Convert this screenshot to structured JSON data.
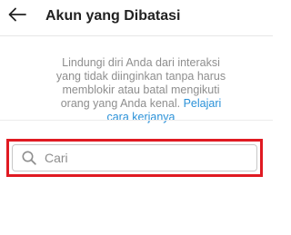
{
  "header": {
    "title": "Akun yang Dibatasi",
    "back_icon": "arrow-left-icon"
  },
  "description": {
    "text": "Lindungi diri Anda dari interaksi yang tidak diinginkan tanpa harus memblokir atau batal mengikuti orang yang Anda kenal.",
    "link": "Pelajari cara kerjanya"
  },
  "search": {
    "placeholder": "Cari",
    "value": "",
    "icon": "search-icon"
  },
  "colors": {
    "link": "#2a91d8",
    "highlight_border": "#e01a22",
    "muted_text": "#8e8e8e"
  }
}
